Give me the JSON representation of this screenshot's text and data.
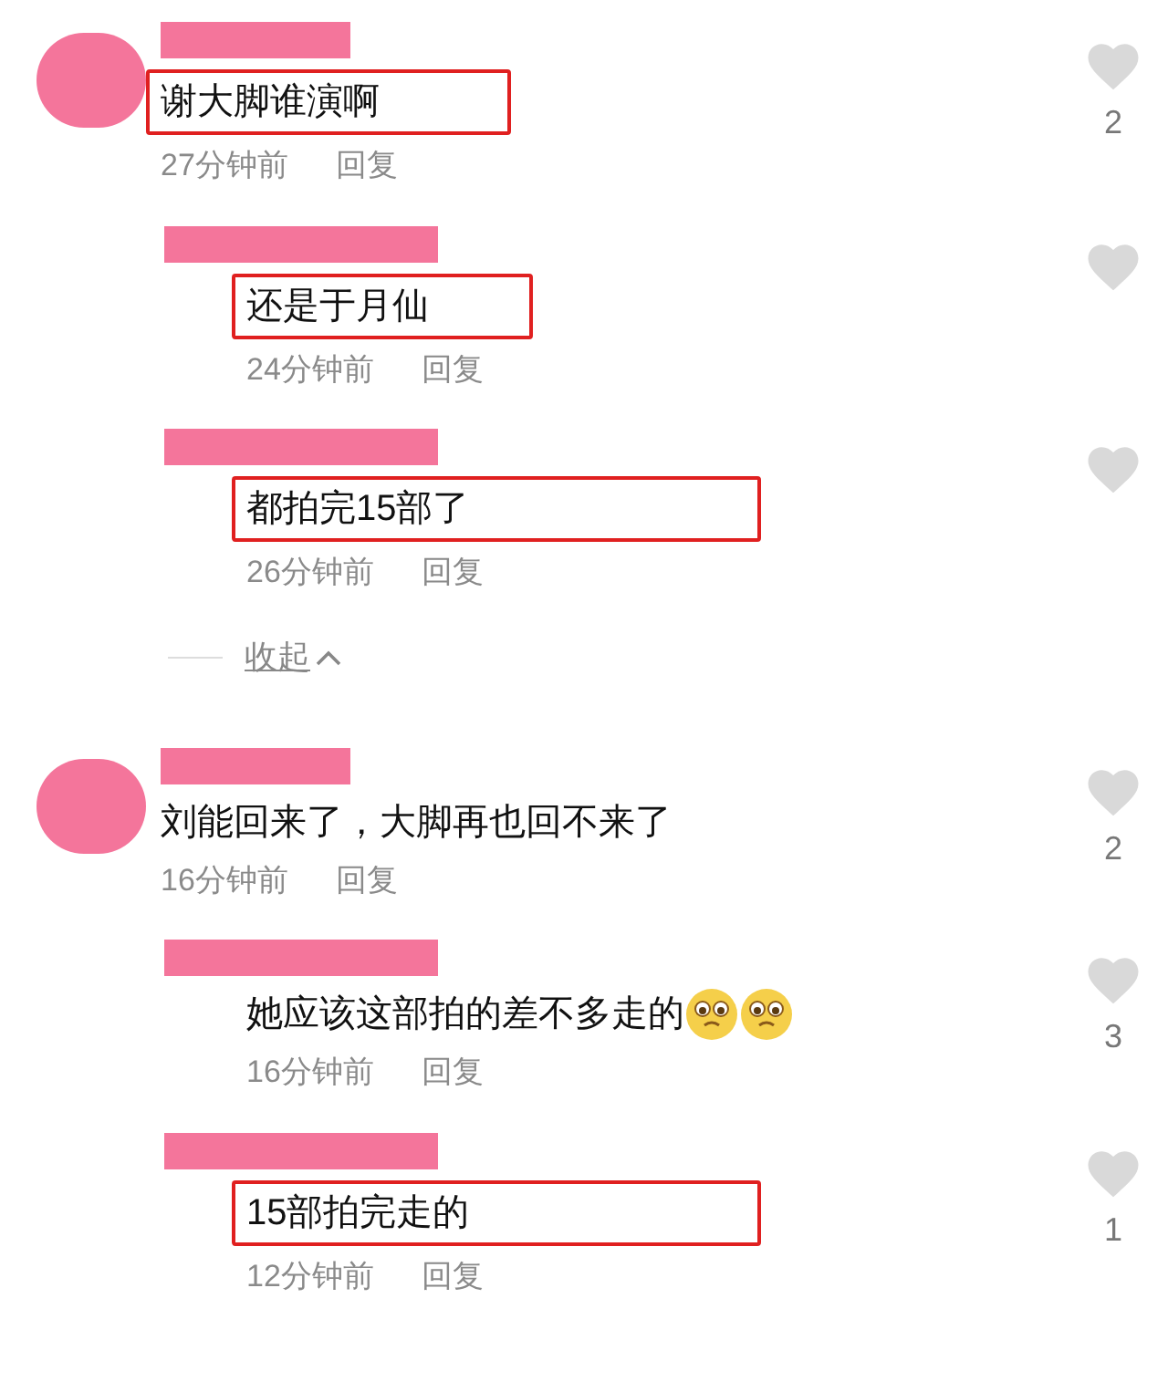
{
  "threads": [
    {
      "comment": {
        "avatar_redacted": true,
        "name_redacted": true,
        "text": "谢大脚谁演啊",
        "highlighted": true,
        "time": "27分钟前",
        "reply_label": "回复",
        "liked": false,
        "like_count": "2"
      },
      "replies": [
        {
          "name_redacted": true,
          "text": "还是于月仙",
          "highlighted": true,
          "time": "24分钟前",
          "reply_label": "回复",
          "liked": false
        },
        {
          "name_redacted": true,
          "text": "都拍完15部了",
          "highlighted": true,
          "time": "26分钟前",
          "reply_label": "回复",
          "liked": false
        }
      ],
      "collapse_label": "收起"
    },
    {
      "comment": {
        "avatar_redacted": true,
        "name_redacted": true,
        "text": "刘能回来了，大脚再也回不来了",
        "highlighted": false,
        "time": "16分钟前",
        "reply_label": "回复",
        "liked": false,
        "like_count": "2"
      },
      "replies": [
        {
          "name_redacted": true,
          "text": "她应该这部拍的差不多走的",
          "emojis": [
            {
              "kind": "pleading"
            },
            {
              "kind": "pleading"
            }
          ],
          "highlighted": false,
          "time": "16分钟前",
          "reply_label": "回复",
          "liked": false,
          "like_count": "3"
        },
        {
          "name_redacted": true,
          "text": "15部拍完走的",
          "highlighted": true,
          "time": "12分钟前",
          "reply_label": "回复",
          "liked": false,
          "like_count": "1"
        }
      ]
    }
  ]
}
